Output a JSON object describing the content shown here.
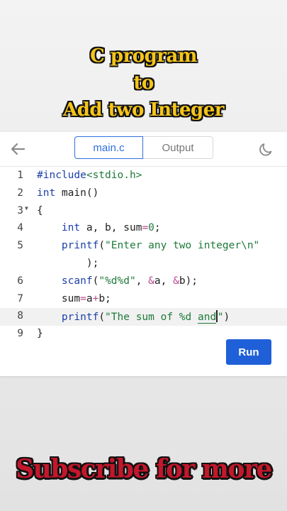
{
  "overlay": {
    "title_lines": [
      "C program",
      "to",
      "Add two Integer"
    ],
    "footer_text": "Subscribe for more",
    "title_color": "#f5c518",
    "footer_color": "#c3172b"
  },
  "toolbar": {
    "back_icon": "arrow-left-icon",
    "theme_icon": "moon-icon",
    "tabs": [
      {
        "label": "main.c",
        "active": true
      },
      {
        "label": "Output",
        "active": false
      }
    ]
  },
  "code": {
    "line_numbers": [
      "1",
      "2",
      "3",
      "4",
      "5",
      "",
      "6",
      "7",
      "8",
      "9"
    ],
    "lines": [
      "#include<stdio.h>",
      "int main()",
      "{",
      "    int a, b, sum=0;",
      "    printf(\"Enter any two integer\\n\"",
      "        );",
      "    scanf(\"%d%d\", &a, &b);",
      "    sum=a+b;",
      "    printf(\"The sum of %d and\")",
      "}"
    ],
    "active_line": "8"
  },
  "run_button": {
    "label": "Run",
    "color": "#1f5fd8"
  }
}
